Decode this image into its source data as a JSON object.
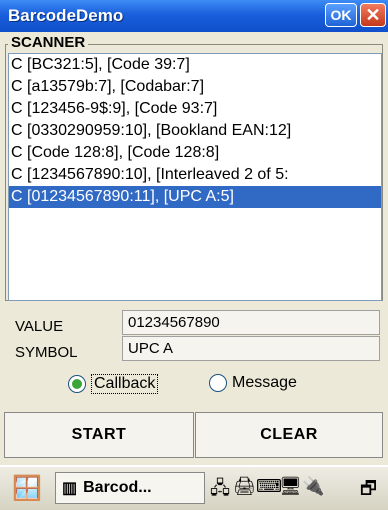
{
  "window": {
    "title": "BarcodeDemo",
    "ok_label": "OK",
    "close_label": "✕"
  },
  "scanner": {
    "label": "SCANNER",
    "entries": [
      "C [BC321:5], [Code 39:7]",
      "C [a13579b:7], [Codabar:7]",
      "C [123456-9$:9], [Code 93:7]",
      "C [0330290959:10], [Bookland EAN:12]",
      "C [Code 128:8], [Code 128:8]",
      "C [1234567890:10], [Interleaved 2 of 5:",
      "C [01234567890:11], [UPC A:5]"
    ],
    "selected_index": 6
  },
  "fields": {
    "value_label": "VALUE",
    "value": "01234567890",
    "symbol_label": "SYMBOL",
    "symbol": "UPC A"
  },
  "mode": {
    "callback_label": "Callback",
    "message_label": "Message",
    "selected": "callback"
  },
  "buttons": {
    "start_label": "START",
    "clear_label": "CLEAR"
  },
  "taskbar": {
    "task_label": "Barcod..."
  },
  "colors": {
    "titlebar": "#1a5fdc",
    "selection": "#316ac5",
    "radio_on": "#3aa63a"
  }
}
